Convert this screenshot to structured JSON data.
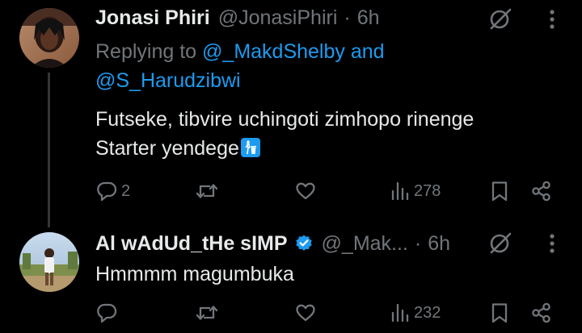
{
  "tweets": [
    {
      "author_name": "Jonasi Phiri",
      "handle": "@JonasiPhiri",
      "separator": "·",
      "time": "6h",
      "replying_prefix": "Replying to",
      "replying_mention1": "@_MakdShelby",
      "replying_and": "and",
      "replying_mention2": "@S_Harudzibwi",
      "text_line1": "Futseke, tibvire uchingoti zimhopo rinenge",
      "text_line2": "Starter yendege",
      "text_emoji": "litter-in-bin-sign-emoji",
      "reply_count": "2",
      "repost_count": "",
      "like_count": "",
      "views_count": "278"
    },
    {
      "author_name": "Al wAdUd_tHe sIMP",
      "verified": true,
      "handle": "@_Mak...",
      "separator": "·",
      "time": "6h",
      "text_line1": "Hmmmm magumbuka",
      "reply_count": "",
      "repost_count": "",
      "like_count": "",
      "views_count": "232"
    }
  ],
  "colors": {
    "background": "#000000",
    "primary_text": "#e7e9ea",
    "secondary_text": "#71767b",
    "link": "#1d9bf0",
    "thread_line": "#333639",
    "verified_badge": "#1d9bf0"
  },
  "icons": [
    "grok-icon",
    "more-icon",
    "reply-icon",
    "repost-icon",
    "like-icon",
    "views-icon",
    "bookmark-icon",
    "share-icon",
    "verified-icon"
  ]
}
